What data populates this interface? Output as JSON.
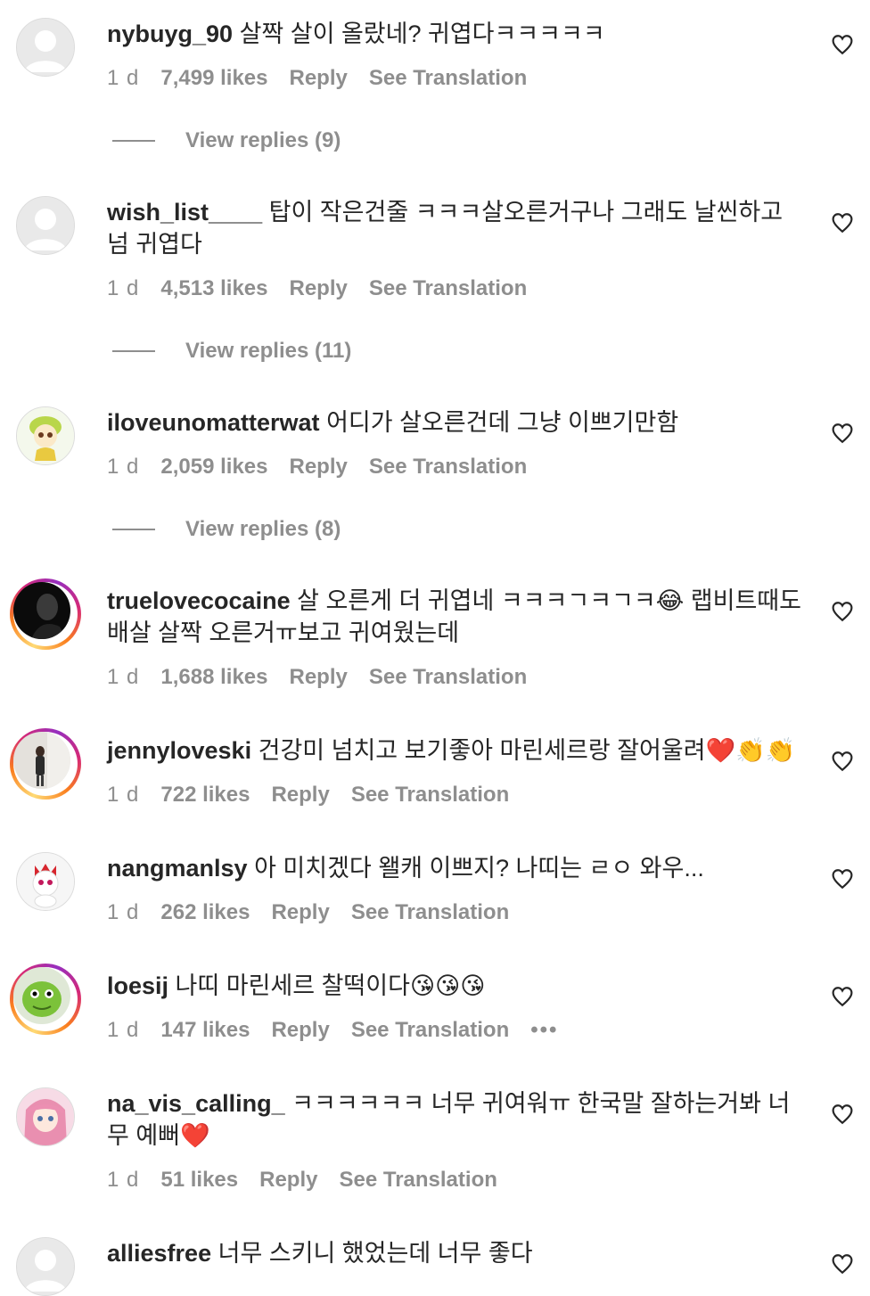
{
  "comments": [
    {
      "username": "nybuyg_90",
      "text": "살짝 살이 올랐네? 귀엽다ㅋㅋㅋㅋㅋ",
      "time": "1 d",
      "likes": "7,499 likes",
      "reply": "Reply",
      "translate": "See Translation",
      "replies": "View replies (9)"
    },
    {
      "username": "wish_list____",
      "text": "탑이 작은건줄 ㅋㅋㅋ살오른거구나 그래도 날씬하고 넘 귀엽다",
      "time": "1 d",
      "likes": "4,513 likes",
      "reply": "Reply",
      "translate": "See Translation",
      "replies": "View replies (11)"
    },
    {
      "username": "iloveunomatterwat",
      "text": "어디가 살오른건데 그냥 이쁘기만함",
      "time": "1 d",
      "likes": "2,059 likes",
      "reply": "Reply",
      "translate": "See Translation",
      "replies": "View replies (8)"
    },
    {
      "username": "truelovecocaine",
      "text": "살 오른게 더 귀엽네 ㅋㅋㅋㄱㅋㄱㅋ😂 랩비트때도 배살 살짝 오른거ㅠ보고 귀여웠는데",
      "time": "1 d",
      "likes": "1,688 likes",
      "reply": "Reply",
      "translate": "See Translation"
    },
    {
      "username": "jennyloveski",
      "text": "건강미 넘치고 보기좋아 마린세르랑 잘어울려❤️👏👏",
      "time": "1 d",
      "likes": "722 likes",
      "reply": "Reply",
      "translate": "See Translation"
    },
    {
      "username": "nangmanlsy",
      "text": "아 미치겠다 왤캐 이쁘지? 나띠는 ㄹㅇ 와우...",
      "time": "1 d",
      "likes": "262 likes",
      "reply": "Reply",
      "translate": "See Translation"
    },
    {
      "username": "loesij",
      "text": "나띠 마린세르 찰떡이다😘😘😘",
      "time": "1 d",
      "likes": "147 likes",
      "reply": "Reply",
      "translate": "See Translation",
      "more": "•••"
    },
    {
      "username": "na_vis_calling_",
      "text": "ㅋㅋㅋㅋㅋㅋ 너무 귀여워ㅠ 한국말 잘하는거봐 너무 예뻐❤️",
      "time": "1 d",
      "likes": "51 likes",
      "reply": "Reply",
      "translate": "See Translation"
    },
    {
      "username": "alliesfree",
      "text": "너무 스키니 했었는데 너무 좋다"
    }
  ],
  "icons": {
    "like": "heart-outline-icon",
    "default_avatar": "default-avatar-icon"
  },
  "colors": {
    "text": "#262626",
    "muted": "#8e8e8e"
  }
}
